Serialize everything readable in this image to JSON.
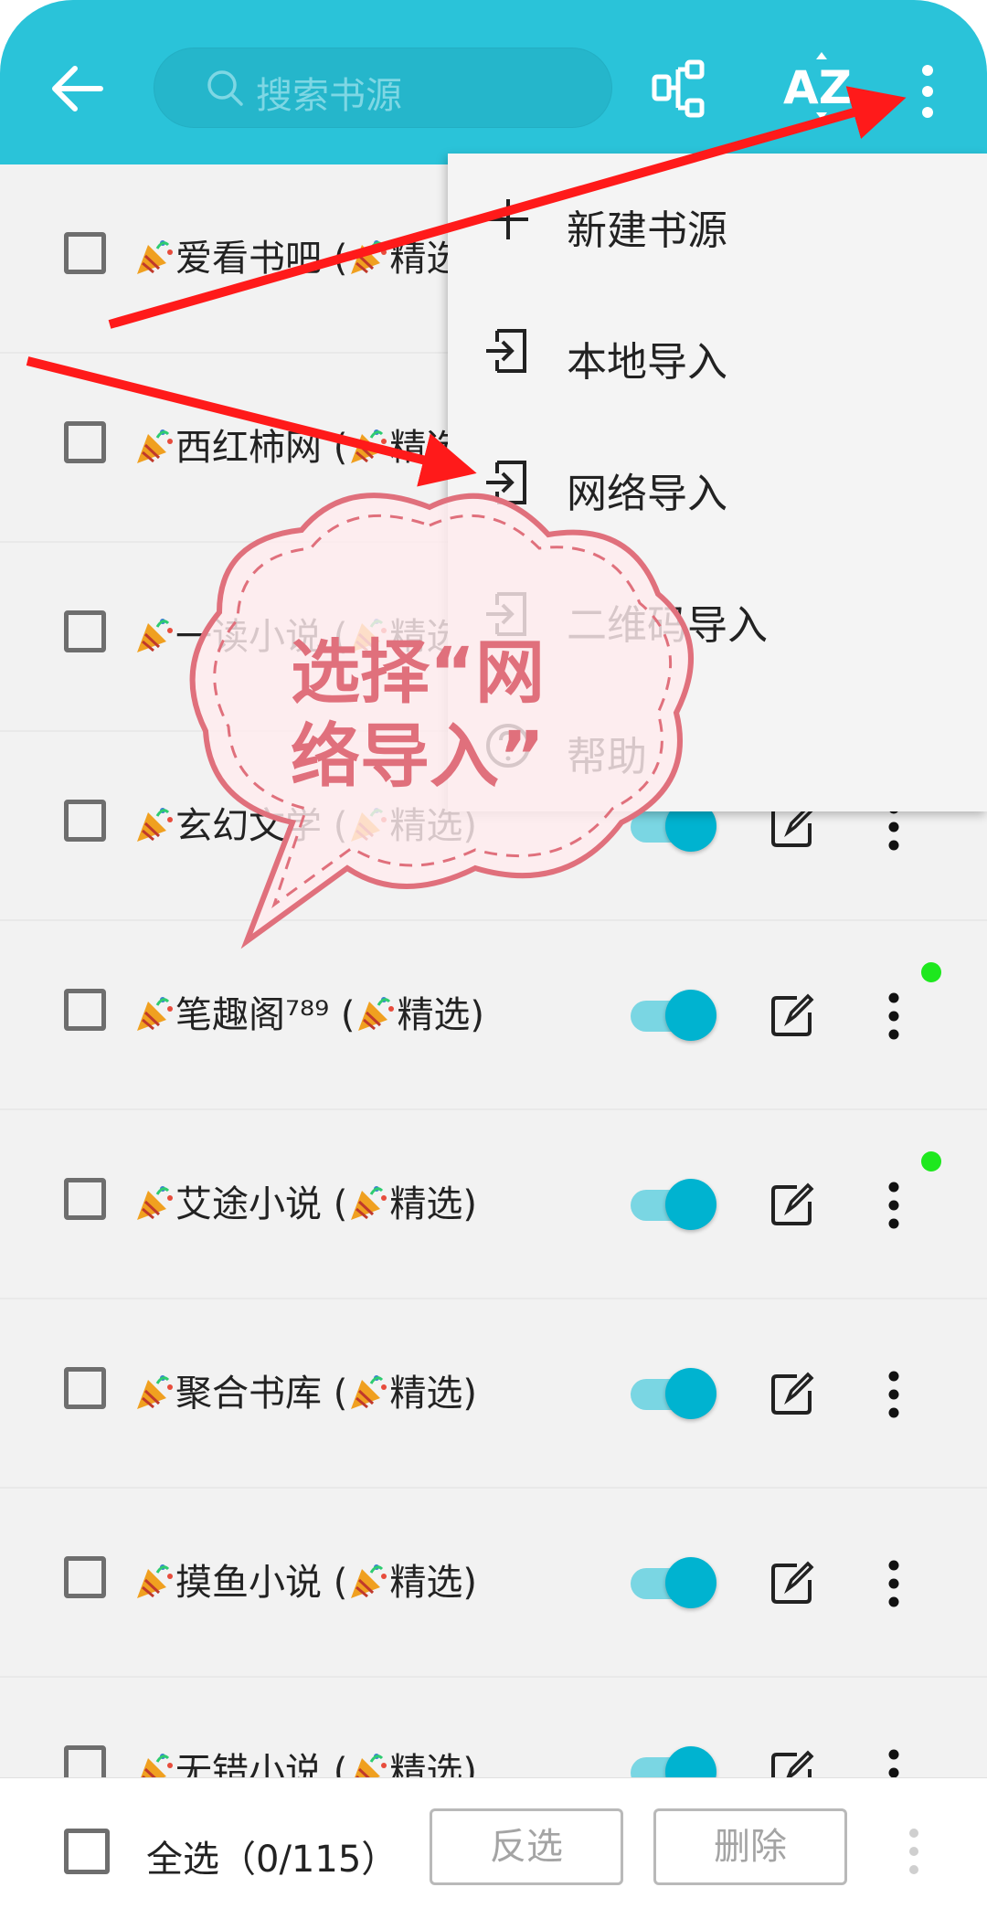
{
  "header": {
    "search_placeholder": "搜索书源",
    "icons": [
      "back-arrow-icon",
      "search-icon",
      "group-sort-icon",
      "az-sort-icon",
      "more-vert-icon"
    ]
  },
  "menu": {
    "items": [
      {
        "label": "新建书源",
        "icon": "plus-icon"
      },
      {
        "label": "本地导入",
        "icon": "import-icon"
      },
      {
        "label": "网络导入",
        "icon": "import-icon"
      },
      {
        "label": "二维码导入",
        "icon": "import-icon"
      },
      {
        "label": "帮助",
        "icon": "help-icon"
      }
    ]
  },
  "list": {
    "rows": [
      {
        "name": "爱看书吧 (",
        "tag": "精选)",
        "enabled": true,
        "dot": false
      },
      {
        "name": "西红柿网 (",
        "tag": "精选)",
        "enabled": true,
        "dot": false
      },
      {
        "name": "一读小说 (",
        "tag": "精选)",
        "enabled": true,
        "dot": false
      },
      {
        "name": "玄幻文学 (",
        "tag": "精选)",
        "enabled": true,
        "dot": false
      },
      {
        "name": "笔趣阁⁷⁸⁹ (",
        "tag": "精选)",
        "enabled": true,
        "dot": true
      },
      {
        "name": "艾途小说 (",
        "tag": "精选)",
        "enabled": true,
        "dot": true
      },
      {
        "name": "聚合书库 (",
        "tag": "精选)",
        "enabled": true,
        "dot": false
      },
      {
        "name": "摸鱼小说 (",
        "tag": "精选)",
        "enabled": true,
        "dot": false
      },
      {
        "name": "无错小说 (",
        "tag": "精选)",
        "enabled": true,
        "dot": false
      }
    ]
  },
  "bottom": {
    "select_all": "全选（0/115）",
    "invert": "反选",
    "delete": "删除"
  },
  "annotation": {
    "callout": "选择“网络导入”",
    "color": "#e0707c",
    "arrow_color": "#ff1a1a"
  },
  "colors": {
    "appbar": "#2ac3d9",
    "toggle_knob": "#00b3d0",
    "status_dot": "#1ee81e"
  }
}
